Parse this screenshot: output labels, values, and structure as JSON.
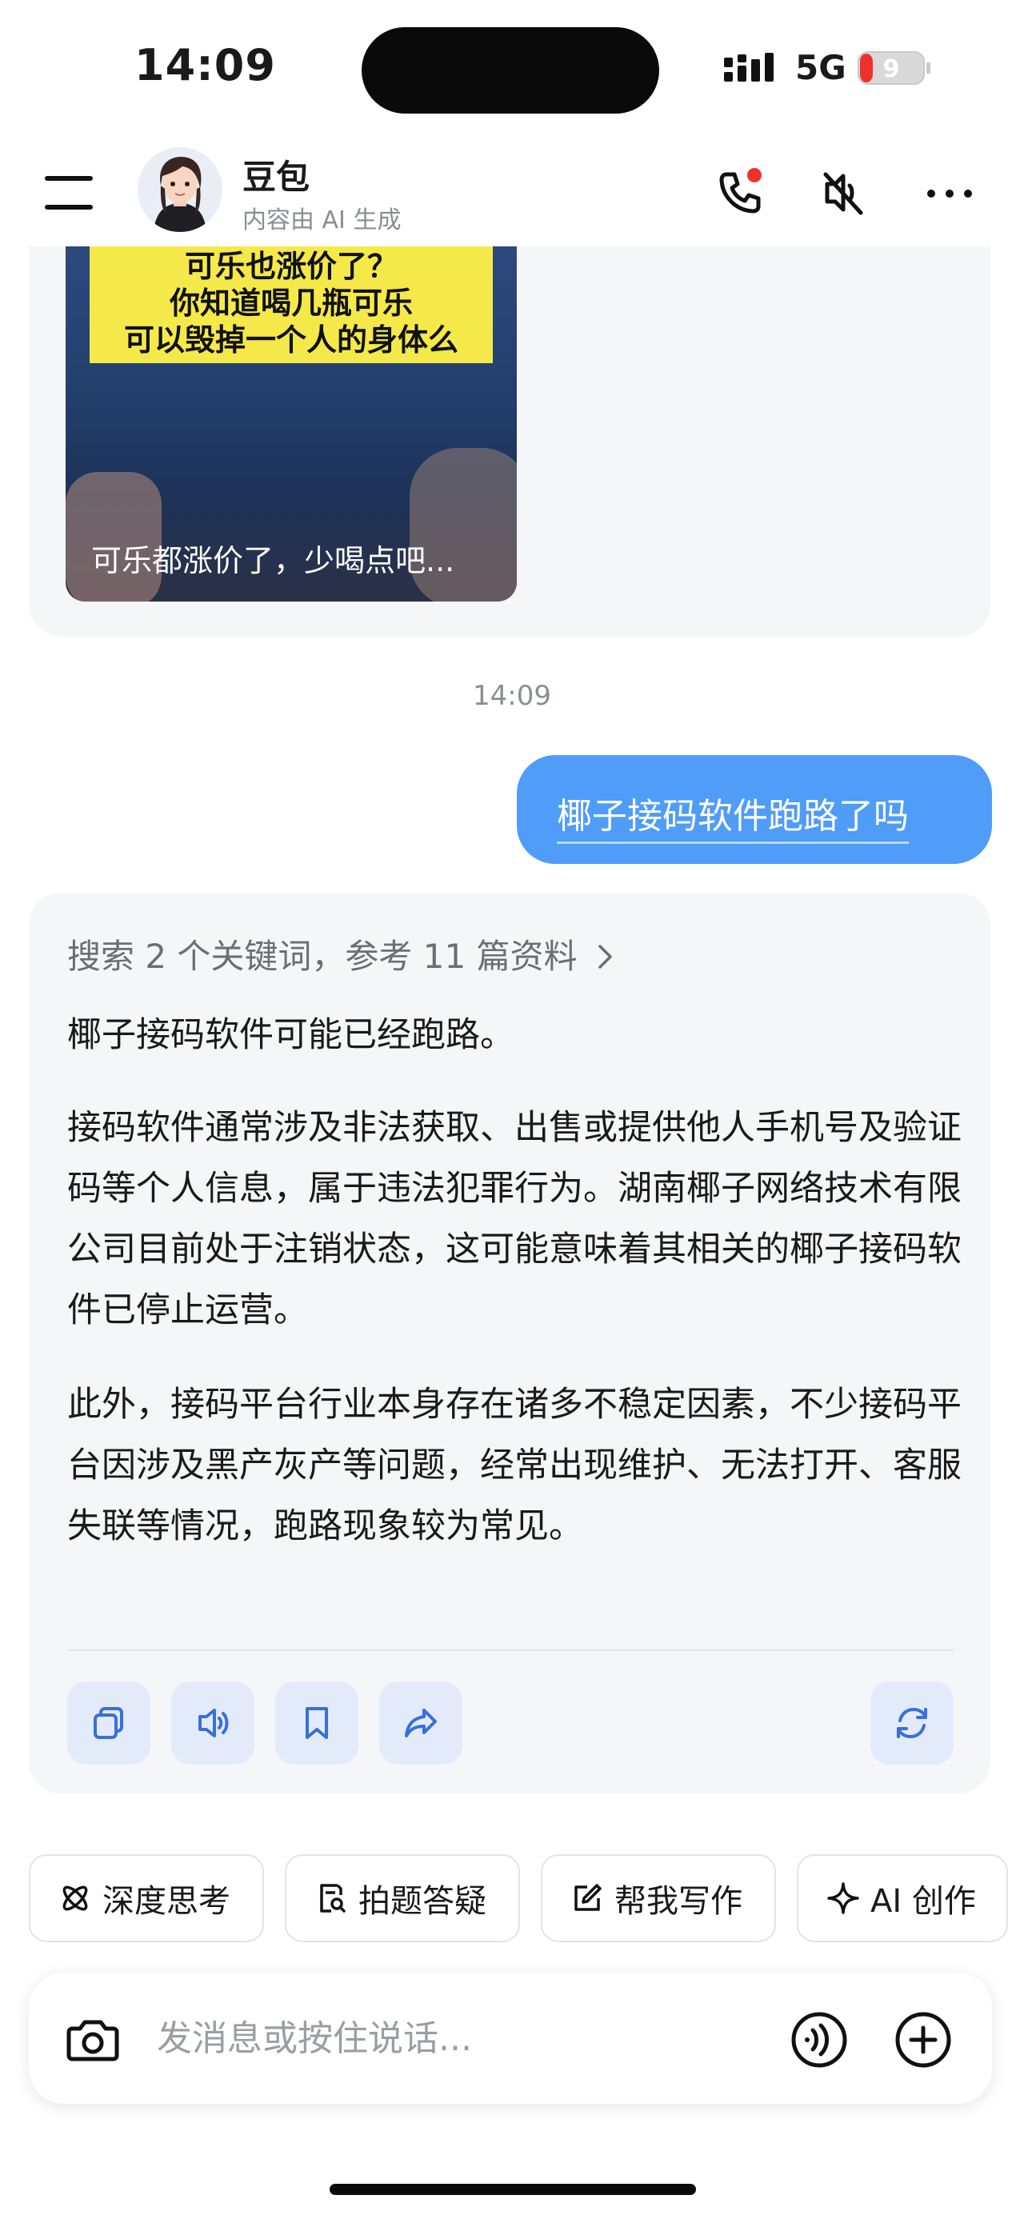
{
  "status_bar": {
    "time": "14:09",
    "network": "5G",
    "battery": "9"
  },
  "header": {
    "bot_name": "豆包",
    "bot_subtitle": "内容由 AI 生成"
  },
  "video_card": {
    "overlay_lines": [
      "可乐也涨价了？",
      "你知道喝几瓶可乐",
      "可以毁掉一个人的身体么"
    ],
    "caption": "可乐都涨价了，少喝点吧..."
  },
  "timestamp": "14:09",
  "user_message": "椰子接码软件跑路了吗",
  "reply": {
    "search_note": "搜索 2 个关键词，参考 11 篇资料",
    "paragraphs": [
      "椰子接码软件可能已经跑路。",
      "接码软件通常涉及非法获取、出售或提供他人手机号及验证码等个人信息，属于违法犯罪行为。湖南椰子网络技术有限公司目前处于注销状态，这可能意味着其相关的椰子接码软件已停止运营。",
      "此外，接码平台行业本身存在诸多不稳定因素，不少接码平台因涉及黑产灰产等问题，经常出现维护、无法打开、客服失联等情况，跑路现象较为常见。"
    ],
    "actions": [
      "copy-icon",
      "speaker-icon",
      "bookmark-icon",
      "share-icon",
      "regenerate-icon"
    ]
  },
  "chips": [
    {
      "label": "深度思考",
      "icon": "atom-icon"
    },
    {
      "label": "拍题答疑",
      "icon": "scan-doc-icon"
    },
    {
      "label": "帮我写作",
      "icon": "edit-icon"
    },
    {
      "label": "AI 创作",
      "icon": "sparkle-icon"
    }
  ],
  "input": {
    "placeholder": "发消息或按住说话..."
  },
  "colors": {
    "accent_blue": "#4f9cf9",
    "icon_blue": "#3a6fd8",
    "card_bg": "#f5f6f8",
    "notification_red": "#f0312a"
  }
}
